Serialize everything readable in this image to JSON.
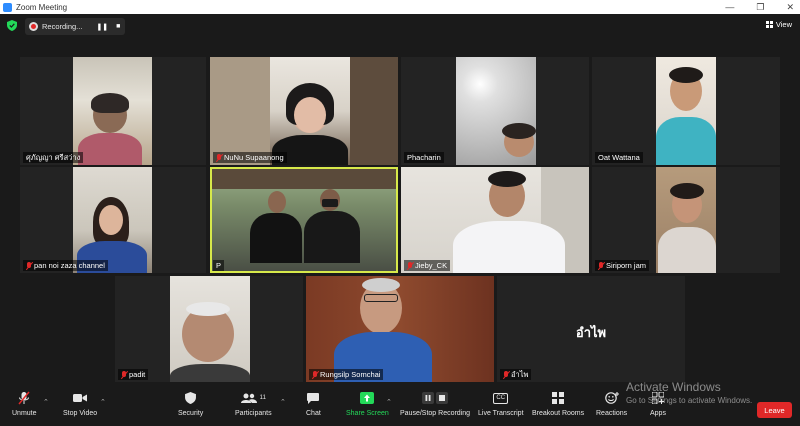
{
  "window": {
    "title": "Zoom Meeting",
    "controls": [
      "—",
      "❐",
      "✕"
    ]
  },
  "topbar": {
    "recording_label": "Recording...",
    "pause_glyph": "❚❚",
    "stop_glyph": "■",
    "view_label": "View"
  },
  "participants": [
    {
      "name": "ศุภัญญา ศรีสว่าง",
      "muted": false
    },
    {
      "name": "NuNu Supaanong",
      "muted": true
    },
    {
      "name": "Phacharin",
      "muted": false
    },
    {
      "name": "Oat Wattana",
      "muted": false
    },
    {
      "name": "pan noi zaza channel",
      "muted": true
    },
    {
      "name": "P",
      "muted": false
    },
    {
      "name": "Jieby_CK",
      "muted": true
    },
    {
      "name": "Siriporn jam",
      "muted": true
    },
    {
      "name": "padit",
      "muted": true
    },
    {
      "name": "Rungsilp Somchai",
      "muted": true
    },
    {
      "name": "อำไพ",
      "muted": true,
      "no_video_label": "อำไพ"
    }
  ],
  "toolbar": {
    "unmute": "Unmute",
    "stop_video": "Stop Video",
    "security": "Security",
    "participants": "Participants",
    "participants_count": "11",
    "chat": "Chat",
    "share_screen": "Share Screen",
    "pause_stop_recording": "Pause/Stop Recording",
    "live_transcript": "Live Transcript",
    "cc_glyph": "CC",
    "breakout_rooms": "Breakout Rooms",
    "reactions": "Reactions",
    "apps": "Apps",
    "leave": "Leave"
  },
  "watermark": {
    "line1": "Activate Windows",
    "line2": "Go to Settings to activate Windows."
  },
  "colors": {
    "share_green": "#23d959",
    "leave_red": "#e02828",
    "active_speaker": "#d7e94a",
    "accent_blue": "#2d8cff"
  }
}
